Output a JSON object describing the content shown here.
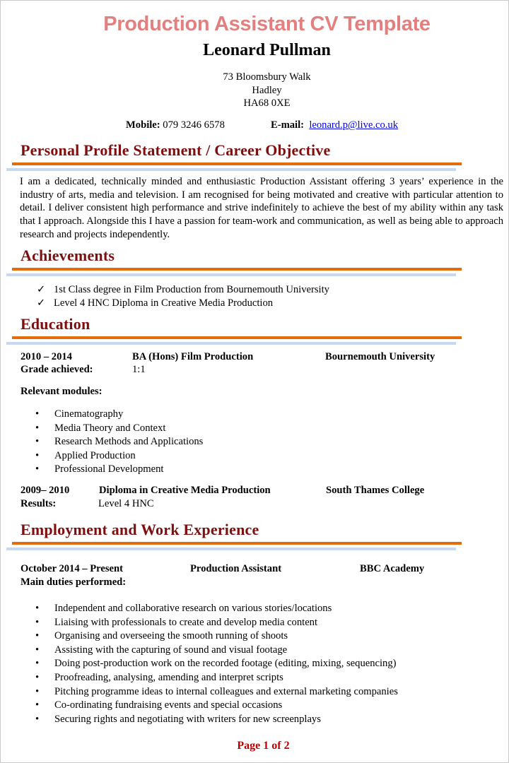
{
  "title": "Production Assistant CV Template",
  "name": "Leonard Pullman",
  "address": [
    "73 Bloomsbury Walk",
    "Hadley",
    "HA68 0XE"
  ],
  "contact": {
    "mobile_label": "Mobile:",
    "mobile": "079 3246 6578",
    "email_label": "E-mail:",
    "email": "leonard.p@live.co.uk"
  },
  "colors": {
    "title": "#e37f7f",
    "heading": "#7f0f0f",
    "orange_rule": "#e46c0a",
    "blue_rule": "#c6d9f1",
    "link": "#0000ee",
    "footer": "#c00000"
  },
  "profile": {
    "heading": "Personal Profile Statement / Career Objective",
    "text": "I am a dedicated, technically minded and enthusiastic Production Assistant offering 3 years’ experience in the industry of arts, media and television. I am recognised for being motivated and creative with particular attention to detail. I deliver consistent high performance and strive indefinitely to achieve the best of my ability within any task that I approach. Alongside this I have a passion for team-work and communication, as well as being able to approach research and projects independently."
  },
  "achievements": {
    "heading": "Achievements",
    "icon": "check-icon",
    "items": [
      "1st Class degree in Film Production from Bournemouth University",
      "Level 4 HNC Diploma in Creative Media Production"
    ]
  },
  "education": {
    "heading": "Education",
    "entries": [
      {
        "dates": "2010 – 2014",
        "qualification": "BA (Hons) Film Production",
        "institution": "Bournemouth University",
        "result_label": "Grade achieved:",
        "result": "1:1",
        "modules_label": "Relevant modules:",
        "modules": [
          "Cinematography",
          "Media Theory and Context",
          "Research Methods and Applications",
          "Applied Production",
          "Professional Development"
        ]
      },
      {
        "dates": "2009– 2010",
        "qualification": "Diploma in Creative Media Production",
        "institution": "South Thames College",
        "result_label": "Results:",
        "result": "Level 4 HNC"
      }
    ]
  },
  "employment": {
    "heading": "Employment and Work Experience",
    "dates": "October 2014 – Present",
    "role": "Production Assistant",
    "employer": "BBC Academy",
    "duties_label": "Main duties performed:",
    "duties": [
      "Independent and collaborative research on various stories/locations",
      "Liaising with professionals to create and develop media content",
      "Organising and overseeing the smooth running of shoots",
      "Assisting with the capturing of sound and visual footage",
      "Doing post-production work on the recorded footage (editing, mixing, sequencing)",
      "Proofreading, analysing, amending and interpret scripts",
      "Pitching programme ideas to internal colleagues and external marketing companies",
      "Co-ordinating fundraising events and special occasions",
      "Securing rights and negotiating with writers for new screenplays"
    ]
  },
  "footer": "Page 1 of 2"
}
